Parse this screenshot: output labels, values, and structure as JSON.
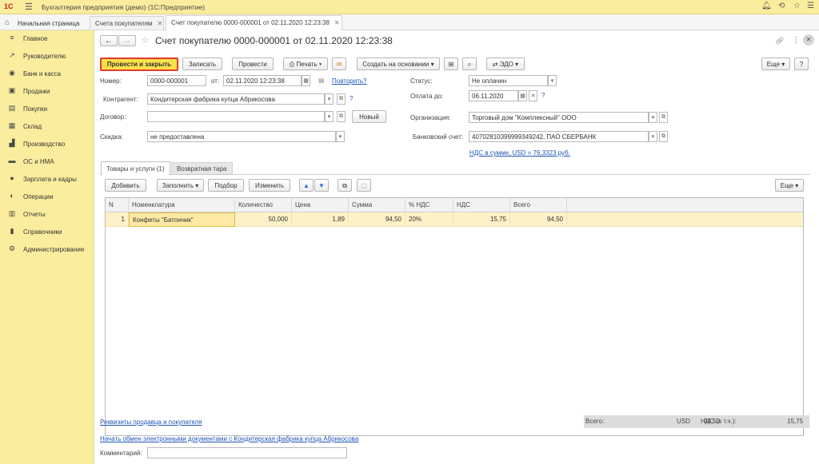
{
  "app": {
    "logo": "1С",
    "title": "Бухгалтерия предприятия (демо)  (1С:Предприятие)"
  },
  "tabs": {
    "home": "Начальная страница",
    "items": [
      {
        "label": "Счета покупателям"
      },
      {
        "label": "Счет покупателю 0000-000001 от 02.11.2020 12:23:38"
      }
    ]
  },
  "sidebar": {
    "items": [
      {
        "label": "Главное",
        "icon": "menu-icon"
      },
      {
        "label": "Руководителю",
        "icon": "chart-up-icon"
      },
      {
        "label": "Банк и касса",
        "icon": "coin-icon"
      },
      {
        "label": "Продажи",
        "icon": "cart-icon"
      },
      {
        "label": "Покупки",
        "icon": "bag-icon"
      },
      {
        "label": "Склад",
        "icon": "warehouse-icon"
      },
      {
        "label": "Производство",
        "icon": "factory-icon"
      },
      {
        "label": "ОС и НМА",
        "icon": "truck-icon"
      },
      {
        "label": "Зарплата и кадры",
        "icon": "person-icon"
      },
      {
        "label": "Операции",
        "icon": "operations-icon"
      },
      {
        "label": "Отчеты",
        "icon": "bar-chart-icon"
      },
      {
        "label": "Справочники",
        "icon": "book-icon"
      },
      {
        "label": "Администрирование",
        "icon": "gear-icon"
      }
    ]
  },
  "doc": {
    "title": "Счет покупателю 0000-000001 от 02.11.2020 12:23:38"
  },
  "toolbar": {
    "post_close": "Провести и закрыть",
    "save": "Записать",
    "post": "Провести",
    "print": "Печать",
    "create_based": "Создать на основании",
    "edo": "ЭДО",
    "more": "Еще",
    "help": "?"
  },
  "form": {
    "number_label": "Номер:",
    "number": "0000-000001",
    "date_label": "от:",
    "date": "02.11.2020 12:23:38",
    "repeat_link": "Повторить?",
    "status_label": "Статус:",
    "status": "Не оплачен",
    "counterparty_label": "Контрагент:",
    "counterparty": "Кондитерская фабрика купца Абрикосова",
    "pay_until_label": "Оплата до:",
    "pay_until": "06.11.2020",
    "contract_label": "Договор:",
    "contract": "",
    "new_button": "Новый",
    "org_label": "Организация:",
    "org": "Торговый дом \"Комплексный\" ООО",
    "discount_label": "Скидка:",
    "discount": "не предоставлена",
    "bank_label": "Банковский счет:",
    "bank": "40702810399999349242, ПАО СБЕРБАНК",
    "vat_link": "НДС в сумме, USD = 79,3323 руб.",
    "question": "?"
  },
  "doc_tabs": [
    {
      "label": "Товары и услуги (1)"
    },
    {
      "label": "Возвратная тара"
    }
  ],
  "table_toolbar": {
    "add": "Добавить",
    "fill": "Заполнить",
    "select": "Подбор",
    "change": "Изменить",
    "more": "Еще"
  },
  "table": {
    "columns": [
      "N",
      "Номенклатура",
      "Количество",
      "Цена",
      "Сумма",
      "% НДС",
      "НДС",
      "Всего"
    ],
    "rows": [
      [
        "1",
        "Конфеты \"Батончик\"",
        "50,000",
        "1,89",
        "94,50",
        "20%",
        "15,75",
        "94,50"
      ]
    ]
  },
  "footer": {
    "requisites_link": "Реквизиты продавца и покупателя",
    "edo_link": "Начать обмен электронными документами с Кондитерская фабрика купца Абрикосова",
    "comment_label": "Комментарий:",
    "comment": "",
    "total_label": "Всего:",
    "total": "94,50",
    "currency": "USD",
    "vat_label": "НДС (в т.ч.):",
    "vat": "15,75"
  }
}
